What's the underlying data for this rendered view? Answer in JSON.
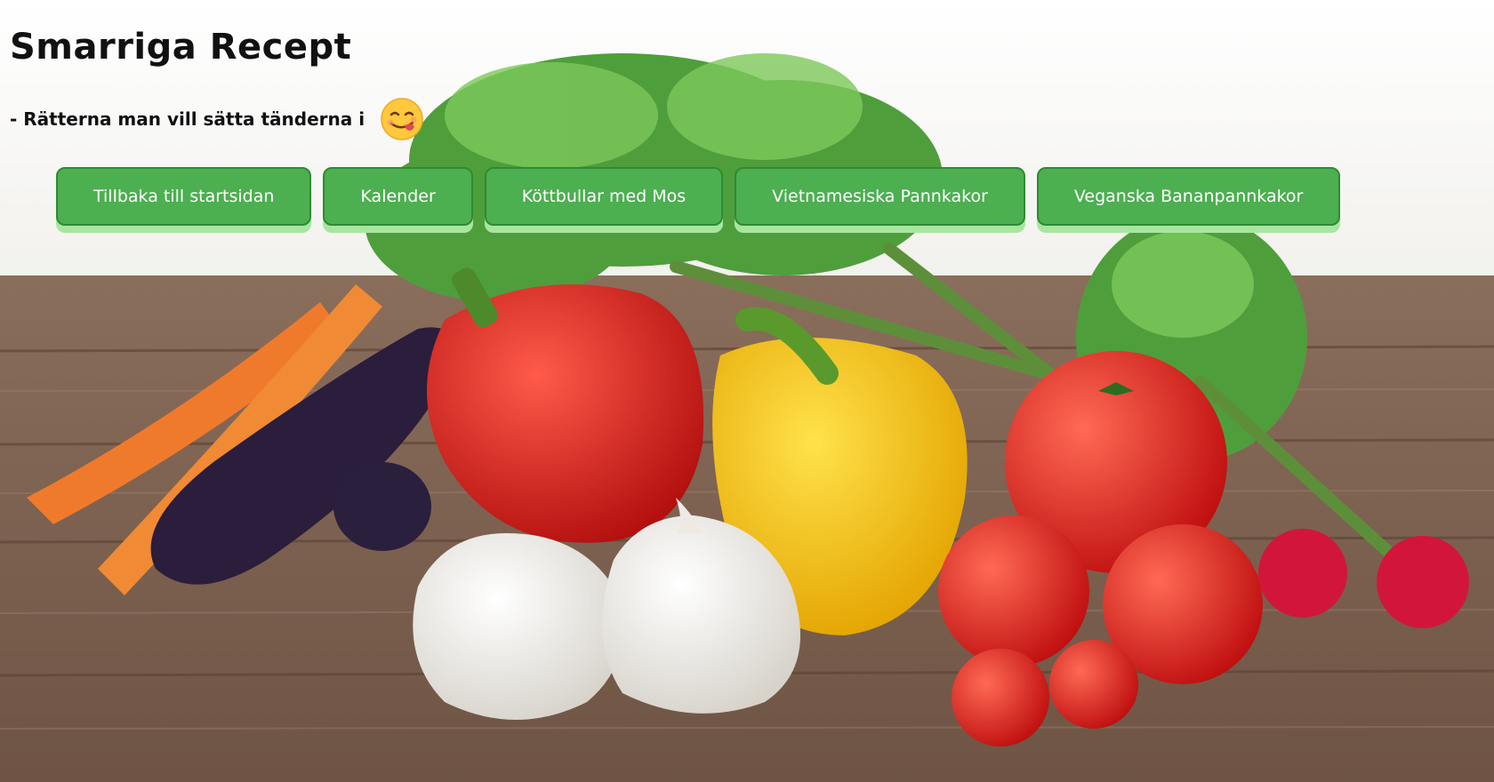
{
  "header": {
    "title": "Smarriga Recept",
    "tagline": "- Rätterna man vill sätta tänderna i",
    "emoji_icon": "face-savoring-food-icon"
  },
  "nav": {
    "items": [
      {
        "label": "Tillbaka till startsidan"
      },
      {
        "label": "Kalender"
      },
      {
        "label": "Köttbullar med Mos"
      },
      {
        "label": "Vietnamesiska Pannkakor"
      },
      {
        "label": "Veganska Bananpannkakor"
      }
    ]
  },
  "theme": {
    "button_color": "#4caf50",
    "button_border": "#2e8b32",
    "button_shadow": "#a8e6a0",
    "text_color": "#111111"
  },
  "background": {
    "image": "vegetables-on-wooden-table"
  }
}
